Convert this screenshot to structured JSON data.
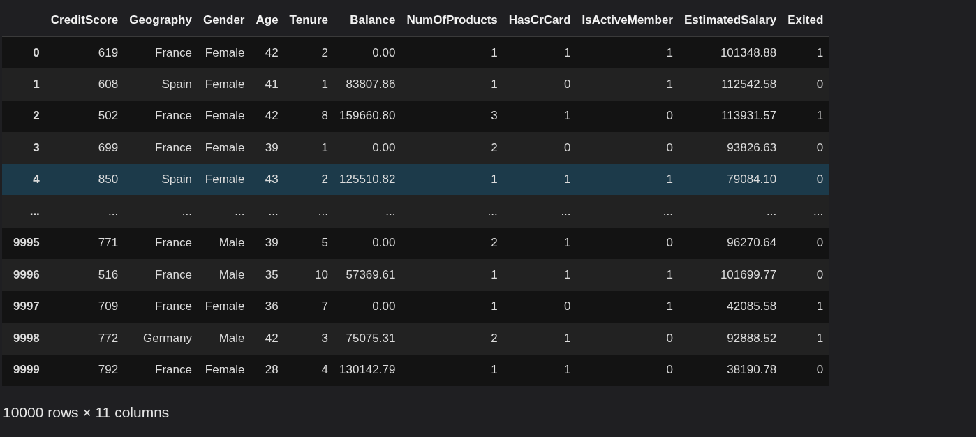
{
  "table": {
    "columns": [
      "CreditScore",
      "Geography",
      "Gender",
      "Age",
      "Tenure",
      "Balance",
      "NumOfProducts",
      "HasCrCard",
      "IsActiveMember",
      "EstimatedSalary",
      "Exited"
    ],
    "rows": [
      {
        "index": "0",
        "cells": [
          "619",
          "France",
          "Female",
          "42",
          "2",
          "0.00",
          "1",
          "1",
          "1",
          "101348.88",
          "1"
        ],
        "highlighted": false
      },
      {
        "index": "1",
        "cells": [
          "608",
          "Spain",
          "Female",
          "41",
          "1",
          "83807.86",
          "1",
          "0",
          "1",
          "112542.58",
          "0"
        ],
        "highlighted": false
      },
      {
        "index": "2",
        "cells": [
          "502",
          "France",
          "Female",
          "42",
          "8",
          "159660.80",
          "3",
          "1",
          "0",
          "113931.57",
          "1"
        ],
        "highlighted": false
      },
      {
        "index": "3",
        "cells": [
          "699",
          "France",
          "Female",
          "39",
          "1",
          "0.00",
          "2",
          "0",
          "0",
          "93826.63",
          "0"
        ],
        "highlighted": false
      },
      {
        "index": "4",
        "cells": [
          "850",
          "Spain",
          "Female",
          "43",
          "2",
          "125510.82",
          "1",
          "1",
          "1",
          "79084.10",
          "0"
        ],
        "highlighted": true
      },
      {
        "index": "...",
        "cells": [
          "...",
          "...",
          "...",
          "...",
          "...",
          "...",
          "...",
          "...",
          "...",
          "...",
          "..."
        ],
        "highlighted": false
      },
      {
        "index": "9995",
        "cells": [
          "771",
          "France",
          "Male",
          "39",
          "5",
          "0.00",
          "2",
          "1",
          "0",
          "96270.64",
          "0"
        ],
        "highlighted": false
      },
      {
        "index": "9996",
        "cells": [
          "516",
          "France",
          "Male",
          "35",
          "10",
          "57369.61",
          "1",
          "1",
          "1",
          "101699.77",
          "0"
        ],
        "highlighted": false
      },
      {
        "index": "9997",
        "cells": [
          "709",
          "France",
          "Female",
          "36",
          "7",
          "0.00",
          "1",
          "0",
          "1",
          "42085.58",
          "1"
        ],
        "highlighted": false
      },
      {
        "index": "9998",
        "cells": [
          "772",
          "Germany",
          "Male",
          "42",
          "3",
          "75075.31",
          "2",
          "1",
          "0",
          "92888.52",
          "1"
        ],
        "highlighted": false
      },
      {
        "index": "9999",
        "cells": [
          "792",
          "France",
          "Female",
          "28",
          "4",
          "130142.79",
          "1",
          "1",
          "0",
          "38190.78",
          "0"
        ],
        "highlighted": false
      }
    ]
  },
  "shape_summary": "10000 rows × 11 columns"
}
